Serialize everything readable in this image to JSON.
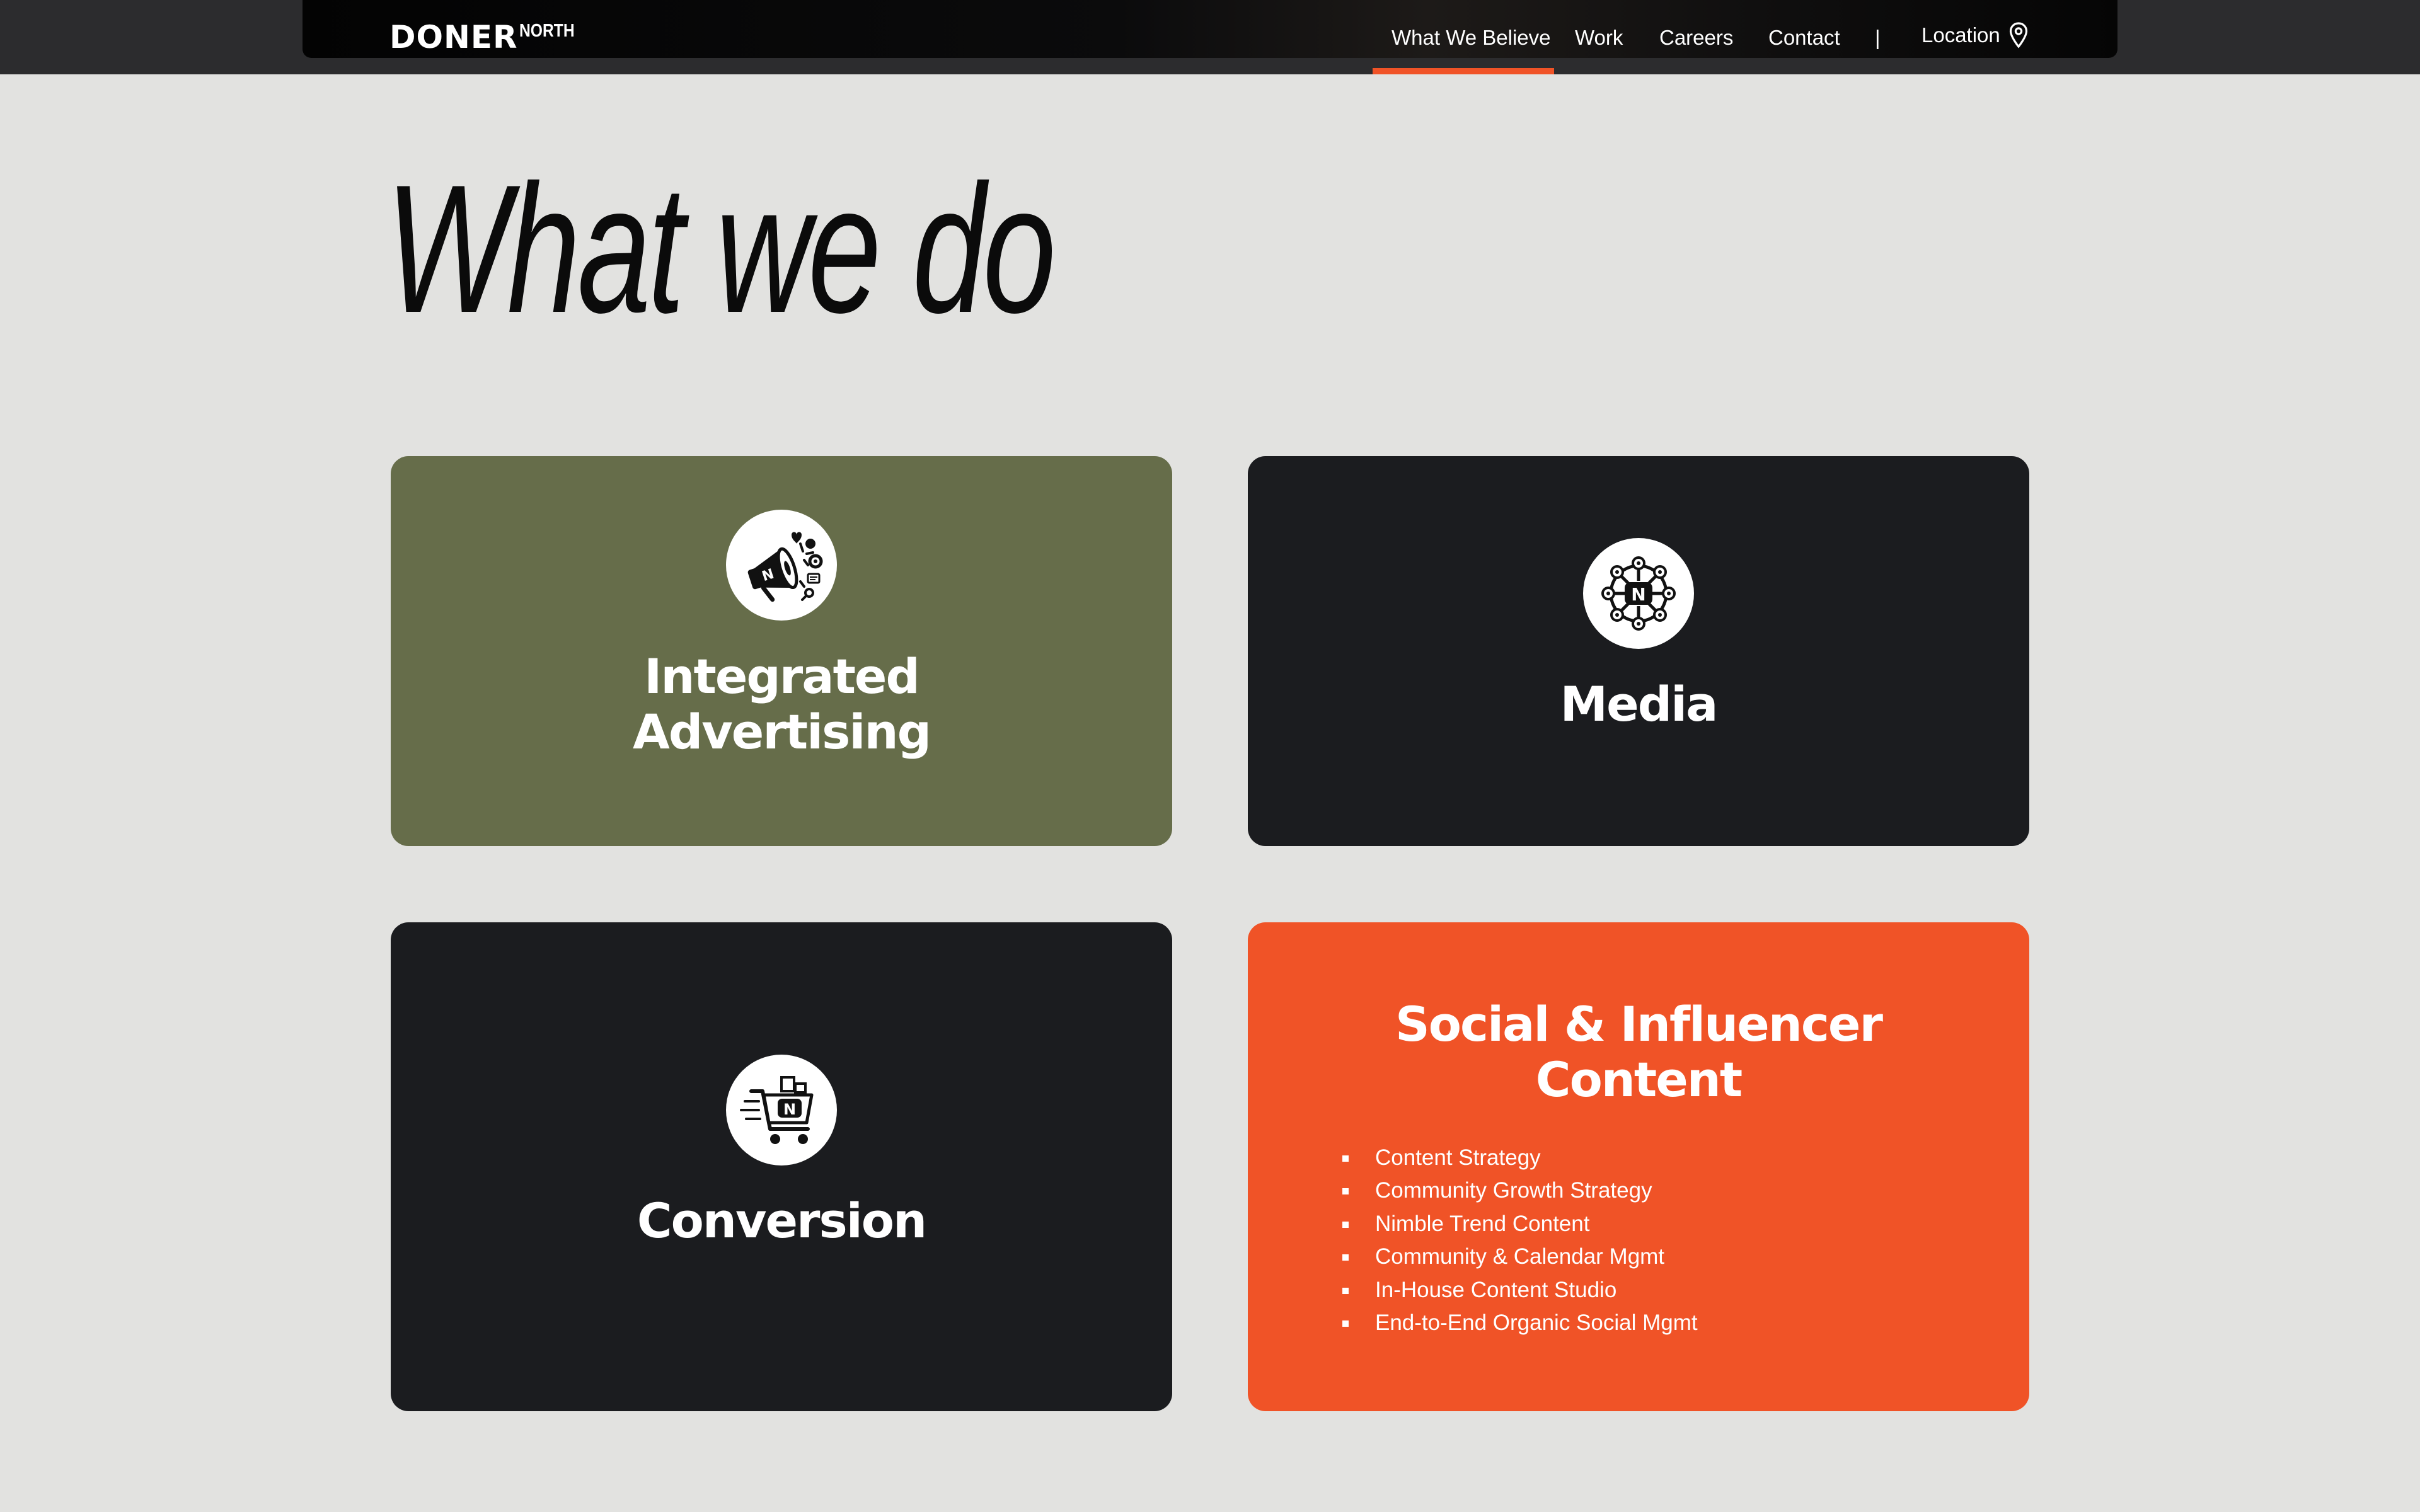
{
  "nav": {
    "logo_main": "DONER",
    "logo_sub": "NORTH",
    "links": [
      {
        "label": "What We Believe",
        "active": true
      },
      {
        "label": "Work",
        "active": false
      },
      {
        "label": "Careers",
        "active": false
      },
      {
        "label": "Contact",
        "active": false
      }
    ],
    "separator": "|",
    "location_label": "Location",
    "location_icon": "map-pin-icon"
  },
  "page": {
    "title": "What we do"
  },
  "cards": [
    {
      "title_lines": [
        "Integrated",
        "Advertising"
      ],
      "icon": "megaphone-icon",
      "color": "#666d4a"
    },
    {
      "title_lines": [
        "Media"
      ],
      "icon": "network-icon",
      "color": "#1b1c1f"
    },
    {
      "title_lines": [
        "Conversion"
      ],
      "icon": "shopping-cart-icon",
      "color": "#1b1c1f"
    },
    {
      "title_lines": [
        "Social & Influencer",
        "Content"
      ],
      "color": "#f05327",
      "items": [
        "Content Strategy",
        "Community Growth Strategy",
        "Nimble Trend Content",
        "Community & Calendar Mgmt",
        "In-House Content Studio",
        "End-to-End Organic Social Mgmt"
      ]
    }
  ],
  "colors": {
    "background": "#e2e2e0",
    "nav_background": "#2c2c2e",
    "accent": "#f05327"
  }
}
